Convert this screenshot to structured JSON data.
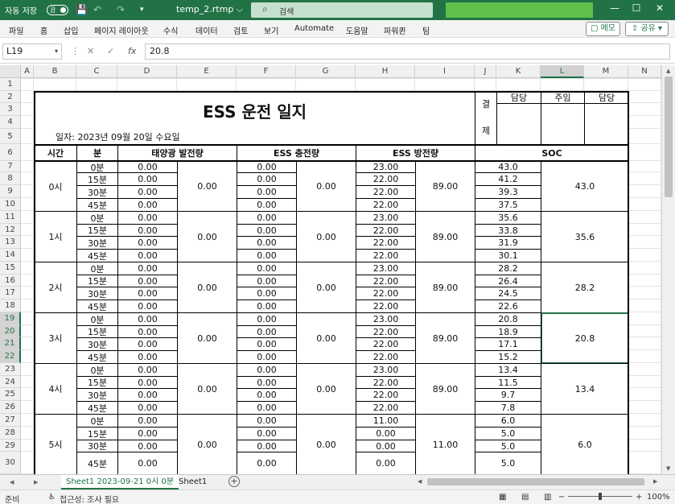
{
  "titlebar": {
    "autosave_label": "자동 저장",
    "autosave_state": "끔",
    "filename": "temp_2.rtmp ⌵",
    "search_placeholder": "검색",
    "accent": "#217346"
  },
  "ribbon": {
    "tabs": [
      "파일",
      "홈",
      "삽입",
      "페이지 레이아웃",
      "수식",
      "데이터",
      "검토",
      "보기",
      "Automate",
      "도움말",
      "파워퀸",
      "팀"
    ],
    "memo_label": "메모",
    "share_label": "공유"
  },
  "formula_bar": {
    "cell_ref": "L19",
    "value": "20.8"
  },
  "columns": [
    "A",
    "B",
    "C",
    "D",
    "E",
    "F",
    "G",
    "H",
    "I",
    "J",
    "K",
    "L",
    "M",
    "N"
  ],
  "rows": [
    "1",
    "2",
    "3",
    "4",
    "5",
    "6",
    "7",
    "8",
    "9",
    "10",
    "11",
    "12",
    "13",
    "14",
    "15",
    "16",
    "17",
    "18",
    "19",
    "20",
    "21",
    "22",
    "23",
    "24",
    "25",
    "26",
    "27",
    "28",
    "29",
    "30"
  ],
  "sheet": {
    "title": "ESS 운전 일지",
    "date_text": "일자: 2023년 09월 20일 수요일",
    "approval": {
      "label_top": "결",
      "label_bottom": "제",
      "roles": [
        "담당",
        "주임",
        "담당"
      ]
    },
    "headers": {
      "hour": "시간",
      "minute": "분",
      "solar": "태양광 발전량",
      "charge": "ESS 충전량",
      "discharge": "ESS 방전량",
      "soc": "SOC"
    },
    "groups": [
      {
        "hour": "0시",
        "minutes": [
          "0분",
          "15분",
          "30분",
          "45분"
        ],
        "solar": [
          "0.00",
          "0.00",
          "0.00",
          "0.00"
        ],
        "solar_total": "0.00",
        "charge": [
          "0.00",
          "0.00",
          "0.00",
          "0.00"
        ],
        "charge_total": "0.00",
        "discharge": [
          "23.00",
          "22.00",
          "22.00",
          "22.00"
        ],
        "discharge_total": "89.00",
        "soc": [
          "43.0",
          "41.2",
          "39.3",
          "37.5"
        ],
        "soc_first": "43.0"
      },
      {
        "hour": "1시",
        "minutes": [
          "0분",
          "15분",
          "30분",
          "45분"
        ],
        "solar": [
          "0.00",
          "0.00",
          "0.00",
          "0.00"
        ],
        "solar_total": "0.00",
        "charge": [
          "0.00",
          "0.00",
          "0.00",
          "0.00"
        ],
        "charge_total": "0.00",
        "discharge": [
          "23.00",
          "22.00",
          "22.00",
          "22.00"
        ],
        "discharge_total": "89.00",
        "soc": [
          "35.6",
          "33.8",
          "31.9",
          "30.1"
        ],
        "soc_first": "35.6"
      },
      {
        "hour": "2시",
        "minutes": [
          "0분",
          "15분",
          "30분",
          "45분"
        ],
        "solar": [
          "0.00",
          "0.00",
          "0.00",
          "0.00"
        ],
        "solar_total": "0.00",
        "charge": [
          "0.00",
          "0.00",
          "0.00",
          "0.00"
        ],
        "charge_total": "0.00",
        "discharge": [
          "23.00",
          "22.00",
          "22.00",
          "22.00"
        ],
        "discharge_total": "89.00",
        "soc": [
          "28.2",
          "26.4",
          "24.5",
          "22.6"
        ],
        "soc_first": "28.2"
      },
      {
        "hour": "3시",
        "minutes": [
          "0분",
          "15분",
          "30분",
          "45분"
        ],
        "solar": [
          "0.00",
          "0.00",
          "0.00",
          "0.00"
        ],
        "solar_total": "0.00",
        "charge": [
          "0.00",
          "0.00",
          "0.00",
          "0.00"
        ],
        "charge_total": "0.00",
        "discharge": [
          "23.00",
          "22.00",
          "22.00",
          "22.00"
        ],
        "discharge_total": "89.00",
        "soc": [
          "20.8",
          "18.9",
          "17.1",
          "15.2"
        ],
        "soc_first": "20.8"
      },
      {
        "hour": "4시",
        "minutes": [
          "0분",
          "15분",
          "30분",
          "45분"
        ],
        "solar": [
          "0.00",
          "0.00",
          "0.00",
          "0.00"
        ],
        "solar_total": "0.00",
        "charge": [
          "0.00",
          "0.00",
          "0.00",
          "0.00"
        ],
        "charge_total": "0.00",
        "discharge": [
          "23.00",
          "22.00",
          "22.00",
          "22.00"
        ],
        "discharge_total": "89.00",
        "soc": [
          "13.4",
          "11.5",
          "9.7",
          "7.8"
        ],
        "soc_first": "13.4"
      },
      {
        "hour": "5시",
        "minutes": [
          "0분",
          "15분",
          "30분",
          "45분"
        ],
        "solar": [
          "0.00",
          "0.00",
          "0.00",
          "0.00"
        ],
        "solar_total": "0.00",
        "charge": [
          "0.00",
          "0.00",
          "0.00",
          "0.00"
        ],
        "charge_total": "0.00",
        "discharge": [
          "11.00",
          "0.00",
          "0.00",
          "0.00"
        ],
        "discharge_total": "11.00",
        "soc": [
          "6.0",
          "5.0",
          "5.0",
          "5.0"
        ],
        "soc_first": "6.0"
      }
    ]
  },
  "sheet_tabs": [
    "Sheet1 2023-09-21 0시 0분",
    "Sheet1"
  ],
  "statusbar": {
    "ready": "준비",
    "accessibility": "접근성: 조사 필요",
    "zoom": "100%"
  }
}
